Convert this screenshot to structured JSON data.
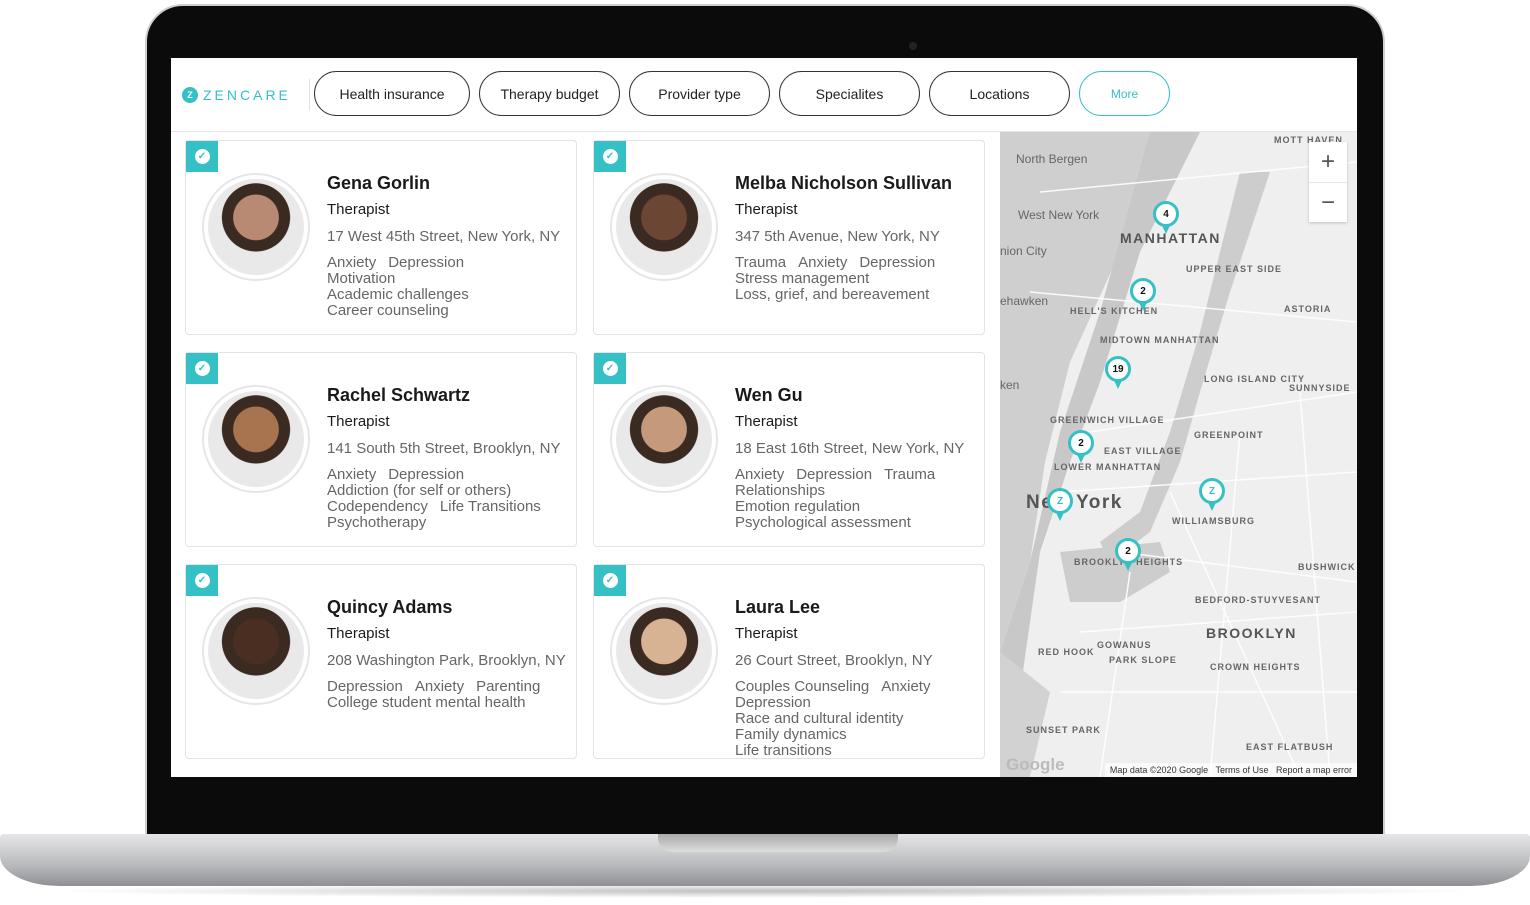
{
  "brand": {
    "logo_letter": "Z",
    "name": "ZENCARE",
    "accent": "#35c0c5"
  },
  "filters": [
    "Health insurance",
    "Therapy budget",
    "Provider type",
    "Specialites",
    "Locations",
    "More"
  ],
  "providers": [
    {
      "name": "Gena Gorlin",
      "role": "Therapist",
      "address": "17 West 45th Street, New York, NY",
      "specialties": [
        [
          "Anxiety",
          "Depression"
        ],
        [
          "Motivation"
        ],
        [
          "Academic challenges"
        ],
        [
          "Career counseling"
        ]
      ]
    },
    {
      "name": "Melba Nicholson Sullivan",
      "role": "Therapist",
      "address": "347 5th Avenue, New York, NY",
      "specialties": [
        [
          "Trauma",
          "Anxiety",
          "Depression"
        ],
        [
          "Stress management"
        ],
        [
          "Loss, grief, and bereavement"
        ]
      ]
    },
    {
      "name": "Rachel Schwartz",
      "role": "Therapist",
      "address": "141 South 5th Street, Brooklyn, NY",
      "specialties": [
        [
          "Anxiety",
          "Depression"
        ],
        [
          "Addiction (for self or others)"
        ],
        [
          "Codependency",
          "Life Transitions"
        ],
        [
          "Psychotherapy"
        ]
      ]
    },
    {
      "name": "Wen Gu",
      "role": "Therapist",
      "address": "18 East 16th Street, New York, NY",
      "specialties": [
        [
          "Anxiety",
          "Depression",
          "Trauma"
        ],
        [
          "Relationships"
        ],
        [
          "Emotion regulation"
        ],
        [
          "Psychological assessment"
        ]
      ]
    },
    {
      "name": "Quincy Adams",
      "role": "Therapist",
      "address": "208 Washington Park, Brooklyn, NY",
      "specialties": [
        [
          "Depression",
          "Anxiety",
          "Parenting"
        ],
        [
          "College student mental health"
        ]
      ]
    },
    {
      "name": "Laura Lee",
      "role": "Therapist",
      "address": "26 Court Street, Brooklyn, NY",
      "specialties": [
        [
          "Couples Counseling",
          "Anxiety"
        ],
        [
          "Depression"
        ],
        [
          "Race and cultural identity"
        ],
        [
          "Family dynamics"
        ],
        [
          "Life transitions"
        ]
      ]
    }
  ],
  "map": {
    "labels": [
      "North Bergen",
      "West New York",
      "nion City",
      "ehawken",
      "ken",
      "MANHATTAN",
      "UPPER EAST SIDE",
      "HELL'S KITCHEN",
      "MIDTOWN MANHATTAN",
      "ASTORIA",
      "LONG ISLAND CITY",
      "SUNNYSIDE",
      "GREENWICH VILLAGE",
      "EAST VILLAGE",
      "GREENPOINT",
      "LOWER MANHATTAN",
      "New York",
      "WILLIAMSBURG",
      "BROOKLYN HEIGHTS",
      "BUSHWICK",
      "BEDFORD-STUYVESANT",
      "BROOKLYN",
      "RED HOOK",
      "GOWANUS",
      "PARK SLOPE",
      "CROWN HEIGHTS",
      "SUNSET PARK",
      "EAST FLATBUSH",
      "MOTT HAVEN"
    ],
    "pins": [
      "4",
      "2",
      "19",
      "2",
      "Z",
      "Z",
      "2"
    ],
    "zoom_in": "+",
    "zoom_out": "−",
    "google": "Google",
    "attribution": "Map data ©2020 Google",
    "terms": "Terms of Use",
    "report": "Report a map error"
  },
  "icons": {
    "verified": "check-circle-icon"
  }
}
